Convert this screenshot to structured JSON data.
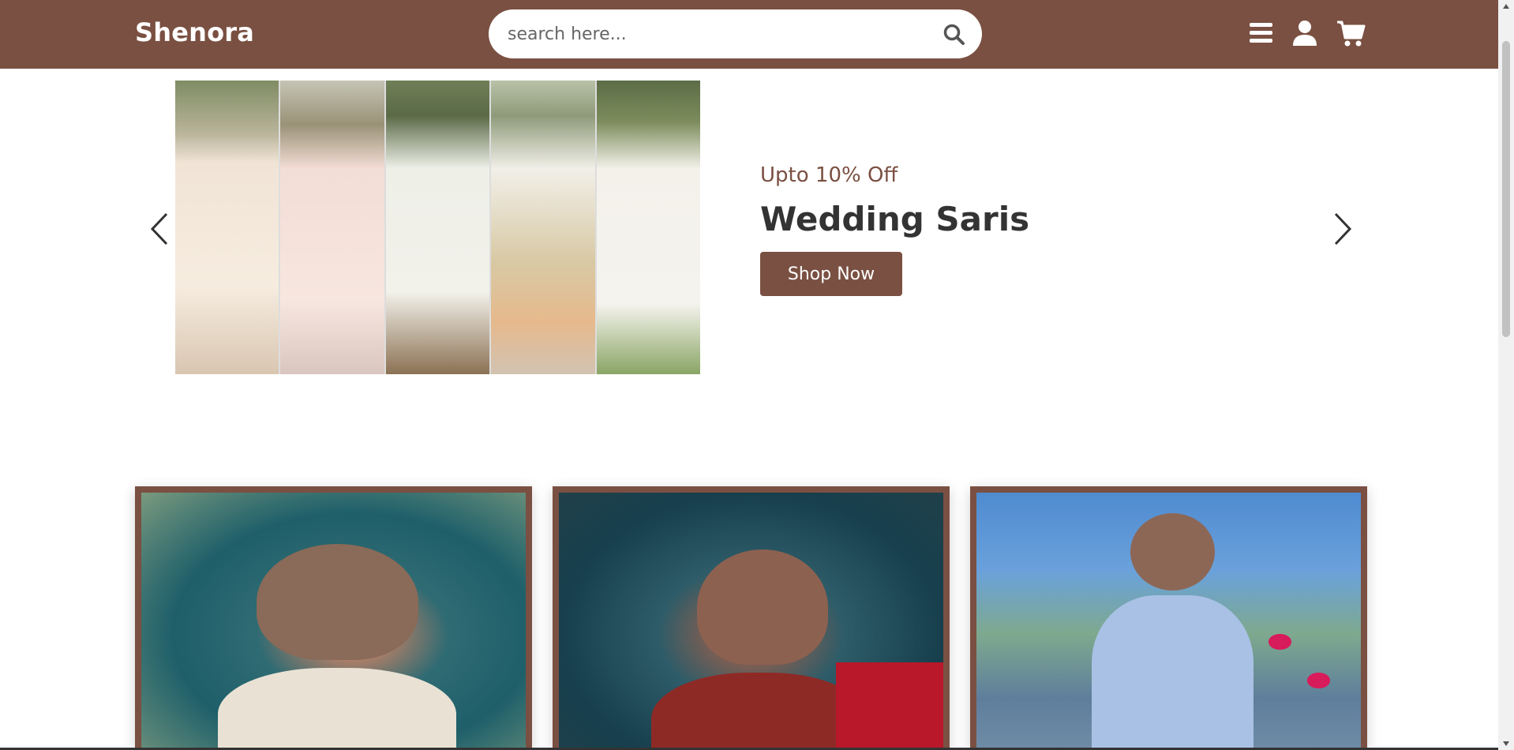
{
  "header": {
    "logo": "Shenora",
    "search": {
      "placeholder": "search here..."
    },
    "icons": [
      "menu-icon",
      "user-icon",
      "cart-icon"
    ],
    "color": "#7a5042"
  },
  "slider": {
    "offer": "Upto 10% Off",
    "title": "Wedding Saris",
    "button": "Shop Now"
  },
  "cards": [
    {
      "image": "bride-in-white-saree-portrait"
    },
    {
      "image": "bride-in-red-bridal-outfit-portrait"
    },
    {
      "image": "bride-in-blue-gown-portrait"
    }
  ],
  "colors": {
    "accent": "#7a5042",
    "text": "#333333"
  }
}
